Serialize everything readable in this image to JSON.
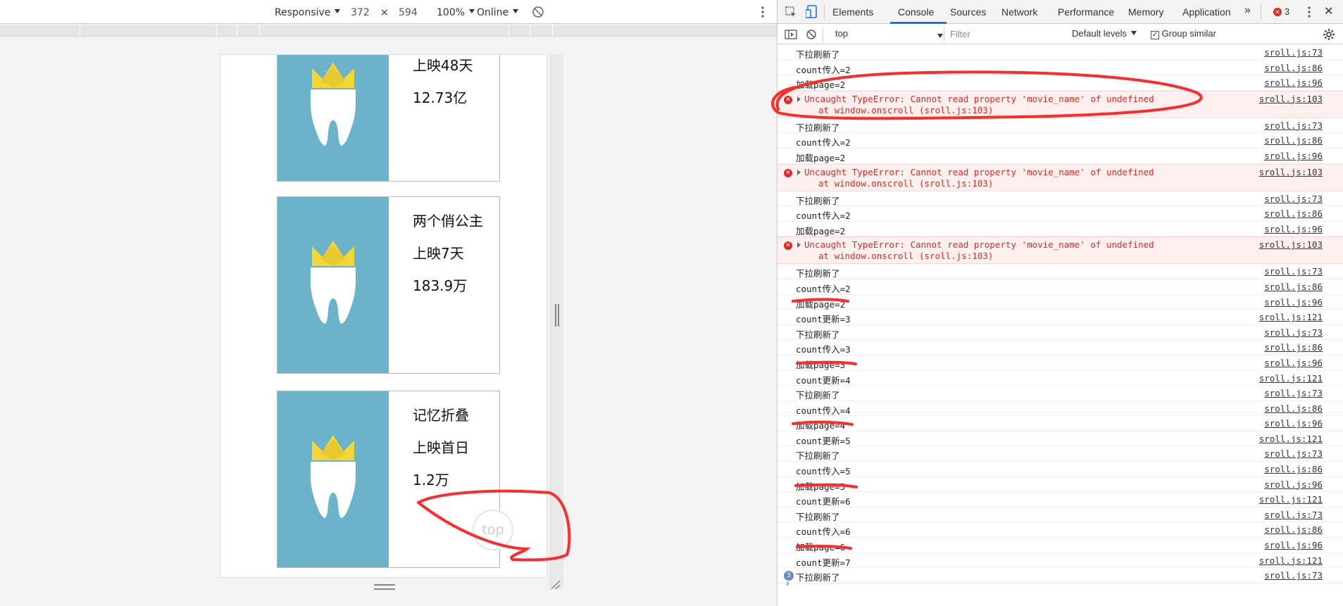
{
  "device_toolbar": {
    "mode": "Responsive",
    "width": "372",
    "times": "×",
    "height": "594",
    "zoom": "100%",
    "network": "Online"
  },
  "movies": [
    {
      "name": "",
      "days": "上映48天",
      "gross": "12.73亿"
    },
    {
      "name": "两个俏公主",
      "days": "上映7天",
      "gross": "183.9万"
    },
    {
      "name": "记忆折叠",
      "days": "上映首日",
      "gross": "1.2万"
    }
  ],
  "top_button": "top",
  "devtools": {
    "tabs": [
      "Elements",
      "Console",
      "Sources",
      "Network",
      "Performance",
      "Memory",
      "Application"
    ],
    "more": "»",
    "error_count": "3",
    "close": "✕",
    "context": "top",
    "filter_placeholder": "Filter",
    "levels": "Default levels",
    "group_similar": "Group similar"
  },
  "console": [
    {
      "type": "log",
      "msg": "下拉刷新了",
      "src": "sroll.js:73"
    },
    {
      "type": "log",
      "msg": "count传入=2",
      "src": "sroll.js:86"
    },
    {
      "type": "log",
      "msg": "加载page=2",
      "src": "sroll.js:96"
    },
    {
      "type": "error",
      "msg": "Uncaught TypeError: Cannot read property 'movie_name' of undefined",
      "msg2": "at window.onscroll (sroll.js:103)",
      "src": "sroll.js:103"
    },
    {
      "type": "log",
      "msg": "下拉刷新了",
      "src": "sroll.js:73"
    },
    {
      "type": "log",
      "msg": "count传入=2",
      "src": "sroll.js:86"
    },
    {
      "type": "log",
      "msg": "加载page=2",
      "src": "sroll.js:96"
    },
    {
      "type": "error",
      "msg": "Uncaught TypeError: Cannot read property 'movie_name' of undefined",
      "msg2": "at window.onscroll (sroll.js:103)",
      "src": "sroll.js:103"
    },
    {
      "type": "log",
      "msg": "下拉刷新了",
      "src": "sroll.js:73"
    },
    {
      "type": "log",
      "msg": "count传入=2",
      "src": "sroll.js:86"
    },
    {
      "type": "log",
      "msg": "加载page=2",
      "src": "sroll.js:96"
    },
    {
      "type": "error",
      "msg": "Uncaught TypeError: Cannot read property 'movie_name' of undefined",
      "msg2": "at window.onscroll (sroll.js:103)",
      "src": "sroll.js:103"
    },
    {
      "type": "log",
      "msg": "下拉刷新了",
      "src": "sroll.js:73"
    },
    {
      "type": "log",
      "msg": "count传入=2",
      "src": "sroll.js:86"
    },
    {
      "type": "log",
      "msg": "加载page=2",
      "src": "sroll.js:96"
    },
    {
      "type": "log",
      "msg": "count更新=3",
      "src": "sroll.js:121"
    },
    {
      "type": "log",
      "msg": "下拉刷新了",
      "src": "sroll.js:73"
    },
    {
      "type": "log",
      "msg": "count传入=3",
      "src": "sroll.js:86"
    },
    {
      "type": "log",
      "msg": "加载page=3",
      "src": "sroll.js:96"
    },
    {
      "type": "log",
      "msg": "count更新=4",
      "src": "sroll.js:121"
    },
    {
      "type": "log",
      "msg": "下拉刷新了",
      "src": "sroll.js:73"
    },
    {
      "type": "log",
      "msg": "count传入=4",
      "src": "sroll.js:86"
    },
    {
      "type": "log",
      "msg": "加载page=4",
      "src": "sroll.js:96"
    },
    {
      "type": "log",
      "msg": "count更新=5",
      "src": "sroll.js:121"
    },
    {
      "type": "log",
      "msg": "下拉刷新了",
      "src": "sroll.js:73"
    },
    {
      "type": "log",
      "msg": "count传入=5",
      "src": "sroll.js:86"
    },
    {
      "type": "log",
      "msg": "加载page=5",
      "src": "sroll.js:96"
    },
    {
      "type": "log",
      "msg": "count更新=6",
      "src": "sroll.js:121"
    },
    {
      "type": "log",
      "msg": "下拉刷新了",
      "src": "sroll.js:73"
    },
    {
      "type": "log",
      "msg": "count传入=6",
      "src": "sroll.js:86"
    },
    {
      "type": "log",
      "msg": "加载page=6",
      "src": "sroll.js:96"
    },
    {
      "type": "log",
      "msg": "count更新=7",
      "src": "sroll.js:121"
    },
    {
      "type": "log",
      "msg": "下拉刷新了",
      "src": "sroll.js:73",
      "repeat": "3"
    }
  ],
  "colors": {
    "poster": "#6bb2cb",
    "crown": "#f5d733",
    "error_red": "#e0291f",
    "annotation_red": "#ff2a2a",
    "accent": "#1a73e8"
  }
}
